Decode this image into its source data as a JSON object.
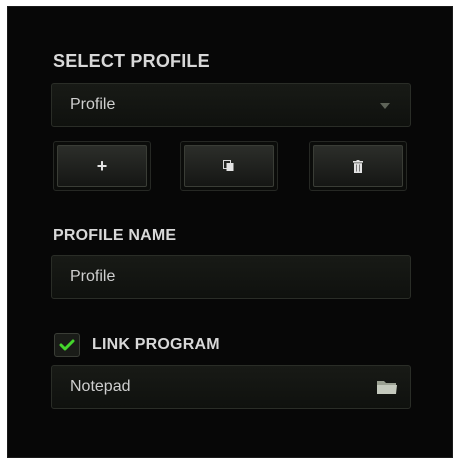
{
  "select_profile": {
    "heading": "SELECT PROFILE",
    "selected_value": "Profile",
    "arrow_icon": "dropdown-arrow-icon"
  },
  "profile_actions": {
    "add_icon": "plus-icon",
    "add_glyph": "+",
    "duplicate_icon": "copy-icon",
    "delete_icon": "trash-icon"
  },
  "profile_name": {
    "heading": "PROFILE NAME",
    "value": "Profile"
  },
  "link_program": {
    "label": "LINK PROGRAM",
    "checked": true,
    "check_color": "#44d62c",
    "program_value": "Notepad",
    "browse_icon": "folder-icon"
  },
  "colors": {
    "panel_background": "#070707",
    "accent": "#44d62c",
    "text": "#d8d8d8"
  }
}
